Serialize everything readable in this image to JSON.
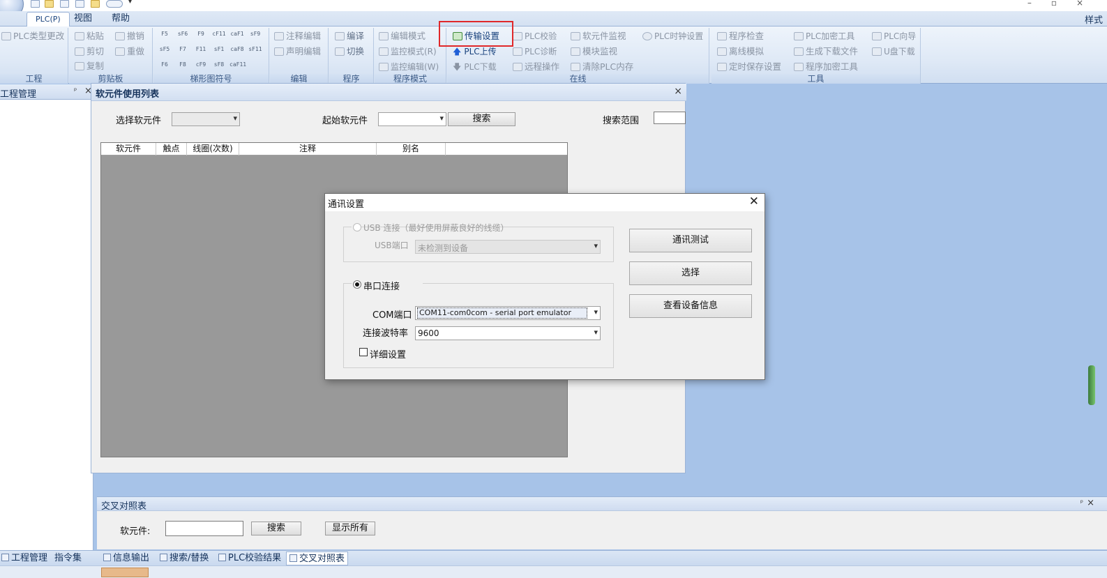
{
  "menu": {
    "tabs": [
      "PLC(P)",
      "视图",
      "帮助"
    ],
    "style_label": "样式"
  },
  "ribbon": {
    "project": {
      "title": "工程",
      "change_plc_type": "PLC类型更改"
    },
    "clipboard": {
      "title": "剪贴板",
      "paste": "粘贴",
      "cut": "剪切",
      "copy": "复制",
      "undo": "撤销",
      "redo": "重做"
    },
    "ladder_symbols": {
      "title": "梯形图符号",
      "row1": [
        "F5",
        "sF6",
        "F9",
        "cF11",
        "caF1",
        "sF9"
      ],
      "row2": [
        "sF5",
        "F7",
        "F11",
        "sF1",
        "caF8",
        "sF11"
      ],
      "row3": [
        "F6",
        "F8",
        "cF9",
        "sF8",
        "caF11"
      ]
    },
    "edit": {
      "title": "编辑",
      "comment_edit": "注释编辑",
      "declaration_edit": "声明编辑"
    },
    "program": {
      "title": "程序",
      "compile": "编译",
      "switch": "切换"
    },
    "program_mode": {
      "title": "程序模式",
      "edit_mode": "编辑模式",
      "monitor_mode": "监控模式(R)",
      "monitor_edit": "监控编辑(W)"
    },
    "online": {
      "title": "在线",
      "transfer_settings": "传输设置",
      "plc_upload": "PLC上传",
      "plc_download": "PLC下载",
      "plc_verify": "PLC校验",
      "plc_diagnose": "PLC诊断",
      "remote_op": "远程操作",
      "device_monitor": "软元件监视",
      "module_monitor": "模块监视",
      "clear_memory": "清除PLC内存",
      "clock_settings": "PLC时钟设置"
    },
    "tools": {
      "title": "工具",
      "program_check": "程序检查",
      "offline_sim": "离线模拟",
      "timed_save": "定时保存设置",
      "encrypt_tool": "PLC加密工具",
      "gen_download_file": "生成下载文件",
      "program_encrypt": "程序加密工具",
      "plc_wizard": "PLC向导",
      "usb_download": "U盘下载"
    }
  },
  "left_panel": {
    "title": "工程管理",
    "pin": "ᵖ",
    "close": "×"
  },
  "device_list": {
    "title": "软元件使用列表",
    "close": "×",
    "select_device_label": "选择软元件",
    "start_device_label": "起始软元件",
    "search_button": "搜索",
    "search_range_label": "搜索范围",
    "columns": [
      "软元件",
      "触点",
      "线圈(次数)",
      "注释",
      "别名"
    ]
  },
  "comm_dialog": {
    "title": "通讯设置",
    "close": "✕",
    "usb_option": "USB 连接（最好使用屏蔽良好的线缆）",
    "usb_port_label": "USB端口",
    "usb_port_value": "未检测到设备",
    "serial_option": "串口连接",
    "com_port_label": "COM端口",
    "com_port_value": "COM11-com0com - serial port emulator",
    "baud_label": "连接波特率",
    "baud_value": "9600",
    "detail_settings": "详细设置",
    "test_button": "通讯测试",
    "select_button": "选择",
    "device_info_button": "查看设备信息"
  },
  "cross_ref": {
    "title": "交叉对照表",
    "device_label": "软元件:",
    "search_button": "搜索",
    "show_all_button": "显示所有",
    "pin": "ᵖ",
    "close": "×"
  },
  "bottom_tabs": [
    "工程管理",
    "指令集",
    "信息输出",
    "搜索/替换",
    "PLC校验结果",
    "交叉对照表"
  ],
  "colors": {
    "highlight": "#e0282a",
    "accent": "#17417c"
  }
}
